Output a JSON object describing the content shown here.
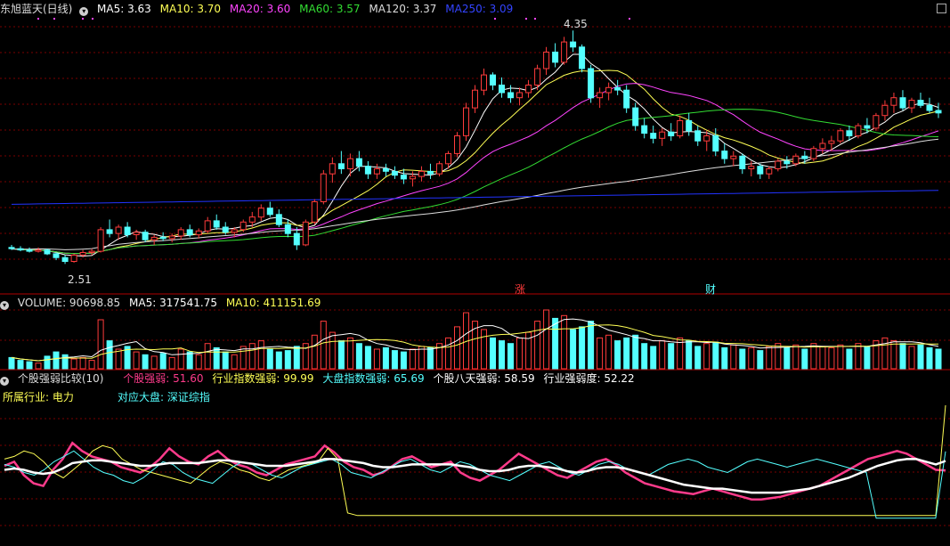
{
  "colors": {
    "up": "#ff3b3b",
    "down": "#54ffff",
    "ma5": "#ffffff",
    "ma10": "#ffff55",
    "ma20": "#ff44ff",
    "ma60": "#33dd33",
    "ma120": "#dddddd",
    "ma250": "#2233ff",
    "grid": "#7a0000",
    "divider": "#b00000"
  },
  "main": {
    "title": "东旭蓝天(日线)",
    "ma": [
      {
        "label": "MA5: 3.63",
        "color": "#ffffff"
      },
      {
        "label": "MA10: 3.70",
        "color": "#ffff55"
      },
      {
        "label": "MA20: 3.60",
        "color": "#ff44ff"
      },
      {
        "label": "MA60: 3.57",
        "color": "#33dd33"
      },
      {
        "label": "MA120: 3.37",
        "color": "#dddddd"
      },
      {
        "label": "MA250: 3.09",
        "color": "#3344ff"
      }
    ],
    "high_label": "4.35",
    "low_label": "2.51",
    "marker_zhang": "涨",
    "marker_cai": "财"
  },
  "volume": {
    "items": [
      {
        "label": "VOLUME: 90698.85",
        "color": "#dddddd"
      },
      {
        "label": "MA5: 317541.75",
        "color": "#ffffff"
      },
      {
        "label": "MA10: 411151.69",
        "color": "#ffff55"
      }
    ]
  },
  "indicator": {
    "title": "个股强弱比较(10)",
    "items": [
      {
        "label": "个股强弱: 51.60",
        "color": "#ff3b8b"
      },
      {
        "label": "行业指数强弱: 99.99",
        "color": "#ffff55"
      },
      {
        "label": "大盘指数强弱: 65.69",
        "color": "#54ffff"
      },
      {
        "label": "个股八天强弱: 58.59",
        "color": "#ffffff"
      },
      {
        "label": "行业强弱度: 52.22",
        "color": "#ffffff"
      }
    ],
    "industry": "所属行业: 电力",
    "market": "对应大盘: 深证综指"
  },
  "chart_data": [
    {
      "type": "candlestick",
      "title": "东旭蓝天(日线)",
      "ylim": [
        2.4,
        4.45
      ],
      "annotations": [
        {
          "label": "4.35",
          "kind": "high"
        },
        {
          "label": "2.51",
          "kind": "low"
        }
      ],
      "ohlc": [
        [
          2.64,
          2.66,
          2.62,
          2.63
        ],
        [
          2.63,
          2.65,
          2.61,
          2.62
        ],
        [
          2.62,
          2.64,
          2.6,
          2.61
        ],
        [
          2.61,
          2.64,
          2.6,
          2.62
        ],
        [
          2.62,
          2.63,
          2.58,
          2.59
        ],
        [
          2.59,
          2.6,
          2.54,
          2.56
        ],
        [
          2.56,
          2.58,
          2.51,
          2.53
        ],
        [
          2.53,
          2.59,
          2.52,
          2.58
        ],
        [
          2.58,
          2.62,
          2.56,
          2.6
        ],
        [
          2.6,
          2.63,
          2.58,
          2.61
        ],
        [
          2.61,
          2.8,
          2.6,
          2.78
        ],
        [
          2.78,
          2.86,
          2.72,
          2.75
        ],
        [
          2.75,
          2.82,
          2.7,
          2.8
        ],
        [
          2.8,
          2.84,
          2.72,
          2.74
        ],
        [
          2.74,
          2.78,
          2.7,
          2.76
        ],
        [
          2.76,
          2.78,
          2.68,
          2.7
        ],
        [
          2.7,
          2.74,
          2.66,
          2.72
        ],
        [
          2.72,
          2.76,
          2.69,
          2.71
        ],
        [
          2.71,
          2.75,
          2.68,
          2.73
        ],
        [
          2.73,
          2.8,
          2.7,
          2.78
        ],
        [
          2.78,
          2.82,
          2.72,
          2.74
        ],
        [
          2.74,
          2.79,
          2.71,
          2.77
        ],
        [
          2.77,
          2.88,
          2.75,
          2.85
        ],
        [
          2.85,
          2.9,
          2.78,
          2.8
        ],
        [
          2.8,
          2.84,
          2.74,
          2.76
        ],
        [
          2.76,
          2.8,
          2.72,
          2.78
        ],
        [
          2.78,
          2.86,
          2.76,
          2.84
        ],
        [
          2.84,
          2.92,
          2.8,
          2.88
        ],
        [
          2.88,
          2.98,
          2.85,
          2.95
        ],
        [
          2.95,
          3.0,
          2.88,
          2.9
        ],
        [
          2.9,
          2.94,
          2.8,
          2.82
        ],
        [
          2.82,
          2.86,
          2.72,
          2.75
        ],
        [
          2.75,
          2.8,
          2.62,
          2.66
        ],
        [
          2.66,
          2.86,
          2.65,
          2.84
        ],
        [
          2.84,
          3.02,
          2.82,
          3.0
        ],
        [
          3.0,
          3.25,
          2.98,
          3.22
        ],
        [
          3.22,
          3.35,
          3.15,
          3.3
        ],
        [
          3.3,
          3.4,
          3.22,
          3.26
        ],
        [
          3.26,
          3.38,
          3.2,
          3.34
        ],
        [
          3.34,
          3.4,
          3.24,
          3.28
        ],
        [
          3.28,
          3.32,
          3.18,
          3.22
        ],
        [
          3.22,
          3.3,
          3.18,
          3.26
        ],
        [
          3.26,
          3.3,
          3.2,
          3.24
        ],
        [
          3.24,
          3.28,
          3.18,
          3.21
        ],
        [
          3.21,
          3.26,
          3.14,
          3.18
        ],
        [
          3.18,
          3.24,
          3.12,
          3.2
        ],
        [
          3.2,
          3.28,
          3.16,
          3.24
        ],
        [
          3.24,
          3.3,
          3.18,
          3.22
        ],
        [
          3.22,
          3.32,
          3.2,
          3.3
        ],
        [
          3.3,
          3.4,
          3.26,
          3.38
        ],
        [
          3.38,
          3.55,
          3.35,
          3.52
        ],
        [
          3.52,
          3.78,
          3.48,
          3.74
        ],
        [
          3.74,
          3.92,
          3.7,
          3.88
        ],
        [
          3.88,
          4.05,
          3.84,
          4.0
        ],
        [
          4.0,
          4.02,
          3.88,
          3.92
        ],
        [
          3.92,
          3.98,
          3.82,
          3.86
        ],
        [
          3.86,
          3.92,
          3.78,
          3.82
        ],
        [
          3.82,
          3.9,
          3.76,
          3.86
        ],
        [
          3.86,
          3.96,
          3.82,
          3.92
        ],
        [
          3.92,
          4.08,
          3.88,
          4.05
        ],
        [
          4.05,
          4.22,
          4.0,
          4.18
        ],
        [
          4.18,
          4.25,
          4.06,
          4.1
        ],
        [
          4.1,
          4.3,
          4.08,
          4.26
        ],
        [
          4.26,
          4.35,
          4.18,
          4.22
        ],
        [
          4.22,
          4.24,
          4.02,
          4.05
        ],
        [
          4.05,
          4.08,
          3.78,
          3.82
        ],
        [
          3.82,
          3.9,
          3.74,
          3.86
        ],
        [
          3.86,
          3.94,
          3.8,
          3.9
        ],
        [
          3.9,
          3.96,
          3.84,
          3.88
        ],
        [
          3.88,
          3.92,
          3.7,
          3.74
        ],
        [
          3.74,
          3.78,
          3.56,
          3.6
        ],
        [
          3.6,
          3.66,
          3.5,
          3.54
        ],
        [
          3.54,
          3.6,
          3.46,
          3.5
        ],
        [
          3.5,
          3.58,
          3.44,
          3.55
        ],
        [
          3.55,
          3.62,
          3.48,
          3.52
        ],
        [
          3.52,
          3.68,
          3.5,
          3.64
        ],
        [
          3.64,
          3.7,
          3.52,
          3.56
        ],
        [
          3.56,
          3.6,
          3.44,
          3.48
        ],
        [
          3.48,
          3.56,
          3.4,
          3.52
        ],
        [
          3.52,
          3.58,
          3.36,
          3.4
        ],
        [
          3.4,
          3.46,
          3.3,
          3.34
        ],
        [
          3.34,
          3.4,
          3.28,
          3.36
        ],
        [
          3.36,
          3.38,
          3.22,
          3.26
        ],
        [
          3.26,
          3.32,
          3.2,
          3.28
        ],
        [
          3.28,
          3.3,
          3.18,
          3.22
        ],
        [
          3.22,
          3.28,
          3.18,
          3.26
        ],
        [
          3.26,
          3.34,
          3.24,
          3.32
        ],
        [
          3.32,
          3.36,
          3.26,
          3.3
        ],
        [
          3.3,
          3.38,
          3.28,
          3.36
        ],
        [
          3.36,
          3.4,
          3.3,
          3.34
        ],
        [
          3.34,
          3.44,
          3.32,
          3.42
        ],
        [
          3.42,
          3.5,
          3.38,
          3.46
        ],
        [
          3.46,
          3.52,
          3.4,
          3.48
        ],
        [
          3.48,
          3.58,
          3.46,
          3.56
        ],
        [
          3.56,
          3.6,
          3.48,
          3.52
        ],
        [
          3.52,
          3.62,
          3.5,
          3.6
        ],
        [
          3.6,
          3.66,
          3.54,
          3.58
        ],
        [
          3.58,
          3.7,
          3.56,
          3.68
        ],
        [
          3.68,
          3.8,
          3.64,
          3.76
        ],
        [
          3.76,
          3.86,
          3.7,
          3.82
        ],
        [
          3.82,
          3.88,
          3.72,
          3.74
        ],
        [
          3.74,
          3.82,
          3.7,
          3.8
        ],
        [
          3.8,
          3.86,
          3.74,
          3.76
        ],
        [
          3.76,
          3.82,
          3.7,
          3.72
        ],
        [
          3.72,
          3.78,
          3.66,
          3.7
        ]
      ],
      "volume": [
        8,
        6,
        5,
        4,
        9,
        12,
        10,
        7,
        8,
        6,
        35,
        20,
        14,
        16,
        12,
        10,
        9,
        11,
        8,
        14,
        12,
        10,
        18,
        15,
        12,
        10,
        16,
        18,
        20,
        14,
        12,
        13,
        16,
        18,
        24,
        34,
        26,
        20,
        22,
        18,
        16,
        14,
        15,
        13,
        12,
        14,
        16,
        15,
        18,
        22,
        30,
        40,
        34,
        28,
        22,
        20,
        18,
        22,
        26,
        34,
        42,
        36,
        38,
        28,
        30,
        34,
        22,
        24,
        20,
        22,
        24,
        18,
        16,
        20,
        18,
        22,
        20,
        16,
        18,
        19,
        15,
        17,
        14,
        15,
        13,
        16,
        18,
        15,
        17,
        14,
        18,
        16,
        15,
        17,
        14,
        18,
        16,
        20,
        22,
        20,
        18,
        16,
        17,
        15,
        14
      ]
    },
    {
      "type": "line",
      "title": "个股强弱比较(10)",
      "series": [
        {
          "name": "个股强弱",
          "values": [
            55,
            58,
            48,
            42,
            40,
            52,
            60,
            72,
            66,
            62,
            60,
            58,
            54,
            52,
            50,
            54,
            60,
            68,
            62,
            58,
            56,
            62,
            66,
            60,
            56,
            54,
            50,
            48,
            52,
            56,
            58,
            60,
            62,
            70,
            65,
            58,
            54,
            52,
            48,
            50,
            55,
            60,
            62,
            58,
            54,
            56,
            58,
            50,
            46,
            44,
            48,
            52,
            58,
            64,
            60,
            56,
            52,
            48,
            46,
            50,
            54,
            58,
            60,
            56,
            50,
            46,
            42,
            40,
            38,
            36,
            35,
            34,
            36,
            38,
            36,
            34,
            32,
            30,
            30,
            31,
            32,
            34,
            36,
            38,
            40,
            44,
            48,
            52,
            56,
            60,
            62,
            64,
            66,
            64,
            60,
            56,
            52,
            51.6
          ]
        },
        {
          "name": "行业指数强弱",
          "values": [
            60,
            62,
            66,
            64,
            58,
            50,
            46,
            52,
            58,
            66,
            70,
            68,
            60,
            56,
            52,
            50,
            48,
            46,
            44,
            42,
            48,
            54,
            58,
            56,
            52,
            50,
            46,
            44,
            48,
            52,
            54,
            56,
            58,
            68,
            60,
            20,
            18,
            18,
            18,
            18,
            18,
            18,
            18,
            18,
            18,
            18,
            18,
            18,
            18,
            18,
            18,
            18,
            18,
            18,
            18,
            18,
            18,
            18,
            18,
            18,
            18,
            18,
            18,
            18,
            18,
            18,
            18,
            18,
            18,
            18,
            18,
            18,
            18,
            18,
            18,
            18,
            18,
            18,
            18,
            18,
            18,
            18,
            18,
            18,
            18,
            18,
            18,
            18,
            18,
            18,
            18,
            18,
            18,
            18,
            18,
            18,
            99.99
          ]
        },
        {
          "name": "大盘指数强弱",
          "values": [
            56,
            54,
            50,
            48,
            52,
            58,
            62,
            66,
            60,
            54,
            50,
            48,
            44,
            42,
            46,
            52,
            58,
            56,
            50,
            46,
            44,
            42,
            48,
            54,
            58,
            56,
            52,
            48,
            46,
            50,
            54,
            56,
            58,
            60,
            56,
            50,
            48,
            46,
            50,
            54,
            58,
            60,
            56,
            52,
            50,
            54,
            58,
            56,
            52,
            48,
            46,
            44,
            48,
            52,
            56,
            58,
            54,
            50,
            48,
            52,
            56,
            58,
            56,
            52,
            50,
            48,
            52,
            56,
            58,
            60,
            58,
            54,
            52,
            50,
            54,
            58,
            60,
            58,
            56,
            54,
            56,
            58,
            60,
            58,
            56,
            54,
            52,
            50,
            16,
            16,
            16,
            16,
            16,
            16,
            16,
            65.69
          ]
        },
        {
          "name": "个股八天强弱",
          "values": [
            52,
            53,
            52,
            50,
            49,
            50,
            53,
            57,
            58,
            59,
            59,
            58,
            57,
            56,
            55,
            55,
            56,
            57,
            57,
            57,
            57,
            58,
            59,
            59,
            58,
            57,
            56,
            55,
            55,
            55,
            56,
            57,
            58,
            60,
            60,
            59,
            58,
            57,
            55,
            54,
            54,
            55,
            56,
            56,
            56,
            56,
            56,
            55,
            54,
            52,
            51,
            51,
            52,
            54,
            55,
            55,
            54,
            53,
            51,
            50,
            51,
            53,
            54,
            54,
            53,
            51,
            49,
            47,
            45,
            43,
            41,
            40,
            39,
            38,
            38,
            37,
            36,
            35,
            35,
            35,
            35,
            36,
            37,
            38,
            40,
            42,
            44,
            46,
            49,
            52,
            55,
            57,
            59,
            60,
            60,
            58,
            56,
            58.59
          ]
        }
      ]
    }
  ]
}
